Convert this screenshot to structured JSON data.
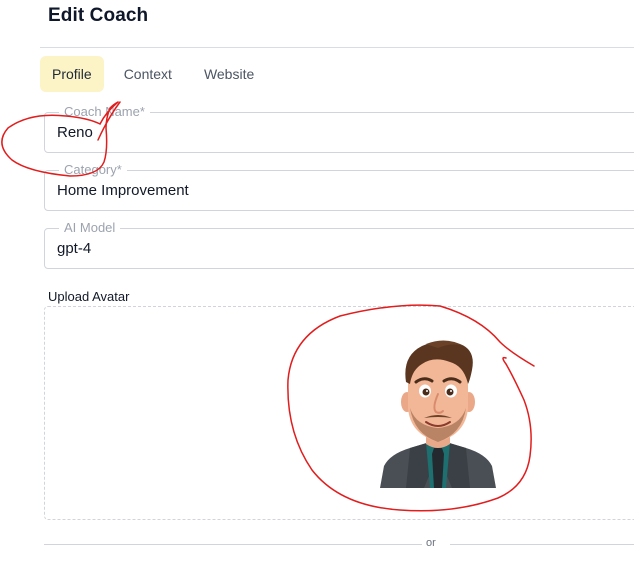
{
  "header": {
    "title": "Edit Coach"
  },
  "tabs": [
    {
      "label": "Profile",
      "active": true
    },
    {
      "label": "Context",
      "active": false
    },
    {
      "label": "Website",
      "active": false
    }
  ],
  "form": {
    "coach_name": {
      "label": "Coach Name*",
      "value": "Reno"
    },
    "category": {
      "label": "Category*",
      "value": "Home Improvement"
    },
    "ai_model": {
      "label": "AI Model",
      "value": "gpt-4"
    }
  },
  "upload": {
    "label": "Upload Avatar",
    "avatar_icon": "cartoon-man-avatar-icon",
    "divider_text": "or"
  },
  "colors": {
    "active_tab_bg": "#fcf3c7",
    "annotation_red": "#e11d1d"
  }
}
